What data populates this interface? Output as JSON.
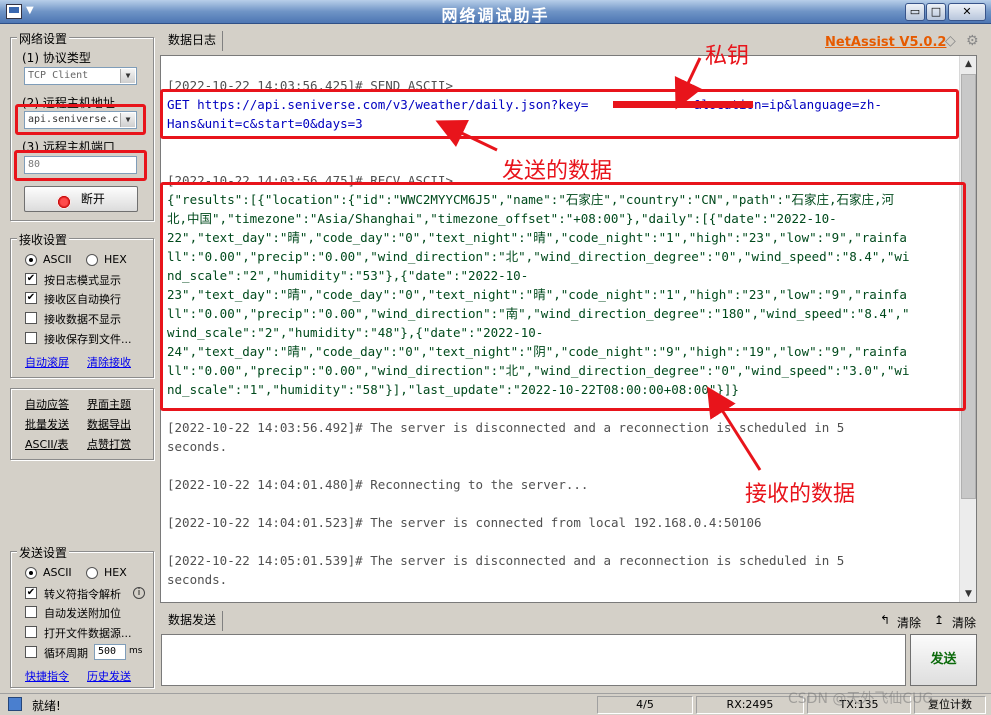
{
  "window": {
    "title": "网络调试助手",
    "brand": "NetAssist V5.0.2",
    "colors": {
      "title_bar": "#4d76b3",
      "annotation": "#e8141b",
      "brand": "#e65a00",
      "send_button": "#0b6a0b"
    }
  },
  "net_settings": {
    "title": "网络设置",
    "protocol_label": "(1) 协议类型",
    "protocol_value": "TCP Client",
    "host_label": "(2) 远程主机地址",
    "host_value": "api.seniverse.c",
    "port_label": "(3) 远程主机端口",
    "port_value": "80",
    "disconnect_label": "断开"
  },
  "recv_settings": {
    "title": "接收设置",
    "ascii": "ASCII",
    "hex": "HEX",
    "ascii_selected": true,
    "options": [
      {
        "label": "按日志模式显示",
        "checked": true
      },
      {
        "label": "接收区自动换行",
        "checked": true
      },
      {
        "label": "接收数据不显示",
        "checked": false
      },
      {
        "label": "接收保存到文件...",
        "checked": false
      }
    ],
    "auto_scroll": "自动滚屏",
    "clear_recv": "清除接收"
  },
  "tools": {
    "auto_reply": "自动应答",
    "theme": "界面主题",
    "batch_send": "批量发送",
    "data_export": "数据导出",
    "ascii_table": "ASCII/表",
    "dot_hit": "点赞打赏"
  },
  "send_settings": {
    "title": "发送设置",
    "ascii": "ASCII",
    "hex": "HEX",
    "options": [
      {
        "label": "转义符指令解析",
        "checked": true
      },
      {
        "label": "自动发送附加位",
        "checked": false
      },
      {
        "label": "打开文件数据源...",
        "checked": false
      },
      {
        "label": "循环周期",
        "checked": false
      }
    ],
    "cycle_value": "500",
    "cycle_unit": "ms",
    "shortcut": "快捷指令",
    "history": "历史发送"
  },
  "log": {
    "tab_label": "数据日志",
    "lines": [
      {
        "text": "[2022-10-22 14:03:56.425]# SEND ASCII>",
        "style": "gray"
      },
      {
        "text": "GET https://api.seniverse.com/v3/weather/daily.json?key=              &location=ip&language=zh-",
        "style": "blue"
      },
      {
        "text": "Hans&unit=c&start=0&days=3",
        "style": "blue"
      },
      {
        "text": "[2022-10-22 14:03:56.475]# RECV ASCII>",
        "style": "gray"
      },
      {
        "text": "{\"results\":[{\"location\":{\"id\":\"WWC2MYYCM6J5\",\"name\":\"石家庄\",\"country\":\"CN\",\"path\":\"石家庄,石家庄,河",
        "style": "green"
      },
      {
        "text": "北,中国\",\"timezone\":\"Asia/Shanghai\",\"timezone_offset\":\"+08:00\"},\"daily\":[{\"date\":\"2022-10-",
        "style": "green"
      },
      {
        "text": "22\",\"text_day\":\"晴\",\"code_day\":\"0\",\"text_night\":\"晴\",\"code_night\":\"1\",\"high\":\"23\",\"low\":\"9\",\"rainfa",
        "style": "green"
      },
      {
        "text": "ll\":\"0.00\",\"precip\":\"0.00\",\"wind_direction\":\"北\",\"wind_direction_degree\":\"0\",\"wind_speed\":\"8.4\",\"wi",
        "style": "green"
      },
      {
        "text": "nd_scale\":\"2\",\"humidity\":\"53\"},{\"date\":\"2022-10-",
        "style": "green"
      },
      {
        "text": "23\",\"text_day\":\"晴\",\"code_day\":\"0\",\"text_night\":\"晴\",\"code_night\":\"1\",\"high\":\"23\",\"low\":\"9\",\"rainfa",
        "style": "green"
      },
      {
        "text": "ll\":\"0.00\",\"precip\":\"0.00\",\"wind_direction\":\"南\",\"wind_direction_degree\":\"180\",\"wind_speed\":\"8.4\",\"",
        "style": "green"
      },
      {
        "text": "wind_scale\":\"2\",\"humidity\":\"48\"},{\"date\":\"2022-10-",
        "style": "green"
      },
      {
        "text": "24\",\"text_day\":\"晴\",\"code_day\":\"0\",\"text_night\":\"阴\",\"code_night\":\"9\",\"high\":\"19\",\"low\":\"9\",\"rainfa",
        "style": "green"
      },
      {
        "text": "ll\":\"0.00\",\"precip\":\"0.00\",\"wind_direction\":\"北\",\"wind_direction_degree\":\"0\",\"wind_speed\":\"3.0\",\"wi",
        "style": "green"
      },
      {
        "text": "nd_scale\":\"1\",\"humidity\":\"58\"}],\"last_update\":\"2022-10-22T08:00:00+08:00\"}]}",
        "style": "green"
      },
      {
        "text": "[2022-10-22 14:03:56.492]# The server is disconnected and a reconnection is scheduled in 5",
        "style": "gray"
      },
      {
        "text": "seconds.",
        "style": "gray"
      },
      {
        "text": "[2022-10-22 14:04:01.480]# Reconnecting to the server...",
        "style": "gray"
      },
      {
        "text": "[2022-10-22 14:04:01.523]# The server is connected from local 192.168.0.4:50106",
        "style": "gray"
      },
      {
        "text": "[2022-10-22 14:05:01.539]# The server is disconnected and a reconnection is scheduled in 5",
        "style": "gray"
      },
      {
        "text": "seconds.",
        "style": "gray"
      }
    ]
  },
  "annotations": {
    "private_key": "私钥",
    "sent_data": "发送的数据",
    "received_data": "接收的数据"
  },
  "send_area": {
    "tab_label": "数据发送",
    "clear1": "清除",
    "clear2": "清除",
    "send_button": "发送"
  },
  "status": {
    "ready": "就绪!",
    "page": "4/5",
    "rx": "RX:2495",
    "tx": "TX:135",
    "reset": "复位计数"
  },
  "watermark": "CSDN @天外飞仙CUG"
}
